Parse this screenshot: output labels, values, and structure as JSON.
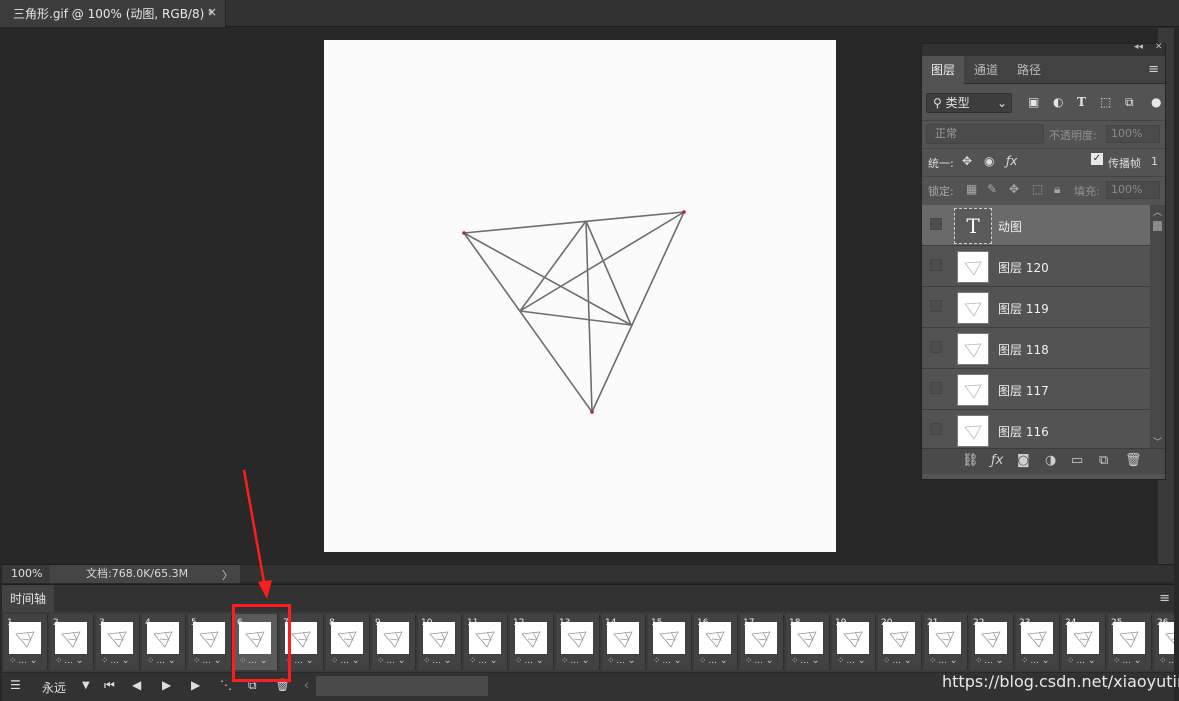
{
  "document_tab": {
    "title": "三角形.gif @ 100% (动图, RGB/8) *",
    "close": "×"
  },
  "status_bar": {
    "zoom": "100%",
    "doc_info": "文档:768.0K/65.3M",
    "arrow": "〉"
  },
  "layers_panel": {
    "tabs": [
      "图层",
      "通道",
      "路径"
    ],
    "active_tab": "图层",
    "filter_kind": "类型",
    "blend_mode": "正常",
    "opacity_label": "不透明度:",
    "opacity_value": "100%",
    "unify_label": "统一:",
    "propagate_frame_label": "传播帧",
    "propagate_frame_value": "1",
    "lock_label": "锁定:",
    "fill_label": "填充:",
    "fill_value": "100%",
    "layers": [
      {
        "name": "动图",
        "type": "text",
        "selected": true
      },
      {
        "name": "图层 120",
        "type": "pixel",
        "selected": false
      },
      {
        "name": "图层 119",
        "type": "pixel",
        "selected": false
      },
      {
        "name": "图层 118",
        "type": "pixel",
        "selected": false
      },
      {
        "name": "图层 117",
        "type": "pixel",
        "selected": false
      },
      {
        "name": "图层 116",
        "type": "pixel",
        "selected": false
      }
    ]
  },
  "timeline": {
    "tab_label": "时间轴",
    "loop_label": "永远",
    "selected_frame": 6,
    "frames": [
      "1",
      "2",
      "3",
      "4",
      "5",
      "6",
      "7",
      "8",
      "9",
      "10",
      "11",
      "12",
      "13",
      "14",
      "15",
      "16",
      "17",
      "18",
      "19",
      "20",
      "21",
      "22",
      "23",
      "24",
      "25",
      "26"
    ],
    "delay_label": "..."
  },
  "colors": {
    "annotation": "#ff1c1c",
    "panel_bg": "#535353",
    "workspace_bg": "#282828"
  },
  "watermark": "https://blog.csdn.net/xiaoyuting_"
}
